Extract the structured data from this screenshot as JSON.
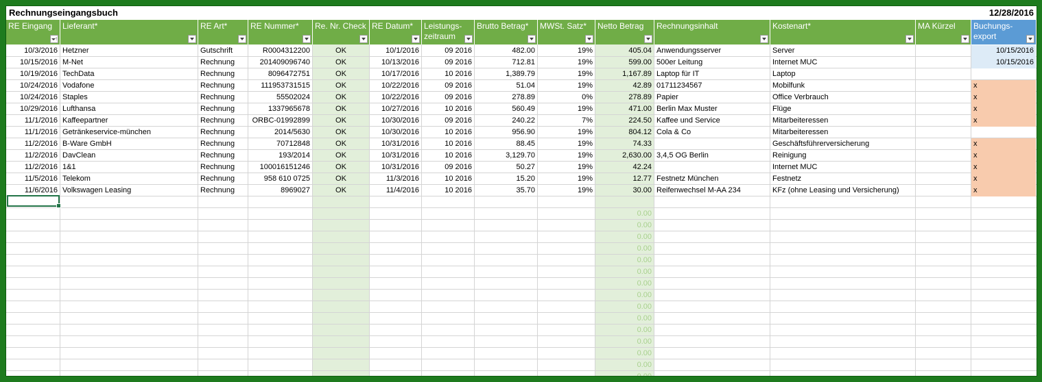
{
  "sheet": {
    "title": "Rechnungseingangsbuch",
    "date": "12/28/2016",
    "headers": [
      {
        "key": "re_eingang",
        "label": "RE Eingang",
        "filter": "sorted"
      },
      {
        "key": "lieferant",
        "label": "Lieferant*",
        "filter": "dropdown"
      },
      {
        "key": "re_art",
        "label": "RE Art*",
        "filter": "dropdown"
      },
      {
        "key": "re_nummer",
        "label": "RE Nummer*",
        "filter": "dropdown"
      },
      {
        "key": "re_check",
        "label": "Re. Nr. Check",
        "filter": "dropdown"
      },
      {
        "key": "re_datum",
        "label": "RE Datum*",
        "filter": "dropdown"
      },
      {
        "key": "leistungszeitraum",
        "label": "Leistungs-\nzeitraum",
        "filter": "dropdown"
      },
      {
        "key": "brutto",
        "label": "Brutto Betrag*",
        "filter": "dropdown"
      },
      {
        "key": "mwst",
        "label": "MWSt. Satz*",
        "filter": "dropdown"
      },
      {
        "key": "netto",
        "label": "Netto Betrag",
        "filter": "dropdown"
      },
      {
        "key": "inhalt",
        "label": "Rechnungsinhalt",
        "filter": "dropdown"
      },
      {
        "key": "kostenart",
        "label": "Kostenart*",
        "filter": "dropdown"
      },
      {
        "key": "ma",
        "label": "MA Kürzel",
        "filter": "dropdown"
      },
      {
        "key": "export",
        "label": "Buchungs-\nexport",
        "filter": "dropdown"
      }
    ],
    "rows": [
      {
        "re_eingang": "10/3/2016",
        "lieferant": "Hetzner",
        "re_art": "Gutschrift",
        "re_nummer": "R0004312200",
        "re_check": "OK",
        "re_datum": "10/1/2016",
        "leistungszeitraum": "09 2016",
        "brutto": "482.00",
        "mwst": "19%",
        "netto": "405.04",
        "inhalt": "Anwendungsserver",
        "kostenart": "Server",
        "ma": "",
        "export": "10/15/2016"
      },
      {
        "re_eingang": "10/15/2016",
        "lieferant": "M-Net",
        "re_art": "Rechnung",
        "re_nummer": "201409096740",
        "re_check": "OK",
        "re_datum": "10/13/2016",
        "leistungszeitraum": "09 2016",
        "brutto": "712.81",
        "mwst": "19%",
        "netto": "599.00",
        "inhalt": "500er Leitung",
        "kostenart": "Internet MUC",
        "ma": "",
        "export": "10/15/2016"
      },
      {
        "re_eingang": "10/19/2016",
        "lieferant": "TechData",
        "re_art": "Rechnung",
        "re_nummer": "8096472751",
        "re_check": "OK",
        "re_datum": "10/17/2016",
        "leistungszeitraum": "10 2016",
        "brutto": "1,389.79",
        "mwst": "19%",
        "netto": "1,167.89",
        "inhalt": "Laptop für IT",
        "kostenart": "Laptop",
        "ma": "",
        "export": ""
      },
      {
        "re_eingang": "10/24/2016",
        "lieferant": "Vodafone",
        "re_art": "Rechnung",
        "re_nummer": "111953731515",
        "re_check": "OK",
        "re_datum": "10/22/2016",
        "leistungszeitraum": "09 2016",
        "brutto": "51.04",
        "mwst": "19%",
        "netto": "42.89",
        "inhalt": "01711234567",
        "kostenart": "Mobilfunk",
        "ma": "",
        "export": "x"
      },
      {
        "re_eingang": "10/24/2016",
        "lieferant": "Staples",
        "re_art": "Rechnung",
        "re_nummer": "55502024",
        "re_check": "OK",
        "re_datum": "10/22/2016",
        "leistungszeitraum": "09 2016",
        "brutto": "278.89",
        "mwst": "0%",
        "netto": "278.89",
        "inhalt": "Papier",
        "kostenart": "Office Verbrauch",
        "ma": "",
        "export": "x"
      },
      {
        "re_eingang": "10/29/2016",
        "lieferant": "Lufthansa",
        "re_art": "Rechnung",
        "re_nummer": "1337965678",
        "re_check": "OK",
        "re_datum": "10/27/2016",
        "leistungszeitraum": "10 2016",
        "brutto": "560.49",
        "mwst": "19%",
        "netto": "471.00",
        "inhalt": "Berlin Max Muster",
        "kostenart": "Flüge",
        "ma": "",
        "export": "x"
      },
      {
        "re_eingang": "11/1/2016",
        "lieferant": "Kaffeepartner",
        "re_art": "Rechnung",
        "re_nummer": "ORBC-01992899",
        "re_check": "OK",
        "re_datum": "10/30/2016",
        "leistungszeitraum": "09 2016",
        "brutto": "240.22",
        "mwst": "7%",
        "netto": "224.50",
        "inhalt": "Kaffee und Service",
        "kostenart": "Mitarbeiteressen",
        "ma": "",
        "export": "x"
      },
      {
        "re_eingang": "11/1/2016",
        "lieferant": "Getränkeservice-münchen",
        "re_art": "Rechnung",
        "re_nummer": "2014/5630",
        "re_check": "OK",
        "re_datum": "10/30/2016",
        "leistungszeitraum": "10 2016",
        "brutto": "956.90",
        "mwst": "19%",
        "netto": "804.12",
        "inhalt": "Cola & Co",
        "kostenart": "Mitarbeiteressen",
        "ma": "",
        "export": ""
      },
      {
        "re_eingang": "11/2/2016",
        "lieferant": "B-Ware GmbH",
        "re_art": "Rechnung",
        "re_nummer": "70712848",
        "re_check": "OK",
        "re_datum": "10/31/2016",
        "leistungszeitraum": "10 2016",
        "brutto": "88.45",
        "mwst": "19%",
        "netto": "74.33",
        "inhalt": "",
        "kostenart": "Geschäftsführerversicherung",
        "ma": "",
        "export": "x"
      },
      {
        "re_eingang": "11/2/2016",
        "lieferant": "DavClean",
        "re_art": "Rechnung",
        "re_nummer": "193/2014",
        "re_check": "OK",
        "re_datum": "10/31/2016",
        "leistungszeitraum": "10 2016",
        "brutto": "3,129.70",
        "mwst": "19%",
        "netto": "2,630.00",
        "inhalt": "3,4,5 OG Berlin",
        "kostenart": "Reinigung",
        "ma": "",
        "export": "x"
      },
      {
        "re_eingang": "11/2/2016",
        "lieferant": "1&1",
        "re_art": "Rechnung",
        "re_nummer": "100016151246",
        "re_check": "OK",
        "re_datum": "10/31/2016",
        "leistungszeitraum": "09 2016",
        "brutto": "50.27",
        "mwst": "19%",
        "netto": "42.24",
        "inhalt": "",
        "kostenart": "Internet MUC",
        "ma": "",
        "export": "x"
      },
      {
        "re_eingang": "11/5/2016",
        "lieferant": "Telekom",
        "re_art": "Rechnung",
        "re_nummer": "958 610 0725",
        "re_check": "OK",
        "re_datum": "11/3/2016",
        "leistungszeitraum": "10 2016",
        "brutto": "15.20",
        "mwst": "19%",
        "netto": "12.77",
        "inhalt": "Festnetz München",
        "kostenart": "Festnetz",
        "ma": "",
        "export": "x"
      },
      {
        "re_eingang": "11/6/2016",
        "lieferant": "Volkswagen Leasing",
        "re_art": "Rechnung",
        "re_nummer": "8969027",
        "re_check": "OK",
        "re_datum": "11/4/2016",
        "leistungszeitraum": "10 2016",
        "brutto": "35.70",
        "mwst": "19%",
        "netto": "30.00",
        "inhalt": "Reifenwechsel M-AA 234",
        "kostenart": "KFz (ohne Leasing und Versicherung)",
        "ma": "",
        "export": "x"
      }
    ],
    "empty_netto": [
      "0.00",
      "0.00",
      "0.00",
      "0.00",
      "0.00",
      "0.00",
      "0.00",
      "0.00",
      "0.00",
      "0.00",
      "0.00",
      "0.00",
      "0.00",
      "0.00",
      "0.00"
    ],
    "colors": {
      "header_green": "#70ad47",
      "header_blue": "#5b9bd5",
      "check_fill": "#e2efda",
      "exported_fill": "#ddebf7",
      "pending_fill": "#f8cbad",
      "frame": "#1e7b1e"
    }
  }
}
